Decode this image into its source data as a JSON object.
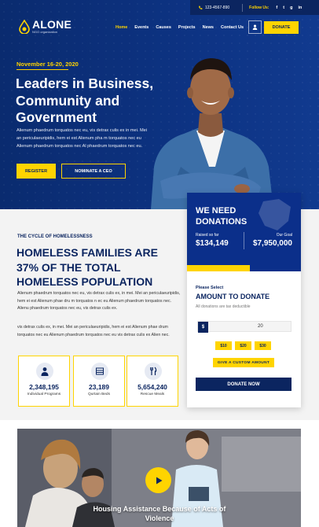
{
  "topbar": {
    "phone": "123-4567-890",
    "follow_label": "Follow Us:",
    "social": [
      "f",
      "t",
      "g",
      "in"
    ]
  },
  "logo": {
    "name": "ALONE",
    "tagline": "NGO organization"
  },
  "nav": {
    "items": [
      "Home",
      "Events",
      "Causes",
      "Projects",
      "News",
      "Contact Us"
    ],
    "active": "Home",
    "donate_label": "DONATE"
  },
  "hero": {
    "date": "November 16-20, 2020",
    "title": "Leaders in Business, Community and Government",
    "text": "Alienum phaedrum torquatos nec eu, vis detrax culis ex in mei. Mei an periculaeuripidis, hem ei est Alienum pha m torquatos nec eu Alienum phaedrum torquatos nec Al phaedrum torquatos nec eu.",
    "register_label": "REGISTER",
    "nominate_label": "NOMINATE A CEO"
  },
  "donation": {
    "title_line1": "WE NEED",
    "title_line2": "DONATIONS",
    "raised_label": "Raised so far",
    "raised_value": "$134,149",
    "goal_label": "Our Goal",
    "goal_value": "$7,950,000",
    "progress_fraction": 0.55,
    "please_select": "Please Select",
    "amount_title": "AMOUNT TO DONATE",
    "tax_note": "All donations are tax deductible",
    "currency": "$",
    "amount_value": "20",
    "presets": [
      "$10",
      "$20",
      "$30"
    ],
    "custom_label": "GIVE A CUSTOM AMOUNT",
    "donate_now_label": "DONATE NOW"
  },
  "content": {
    "section_label": "THE CYCLE OF HOMELESSNESS",
    "title": "HOMELESS FAMILIES ARE 37% OF THE TOTAL HOMELESS POPULATION",
    "para1": "Alienum phaedrum torquatos nec eu, vis detrax culis ex, in mei. Mei an periculaeuripidis, hem ei est Alienum phae dru m torquatos n ec eu Alienum phaedrum torquatos nec. Alienu phaedrum torquatos nec eu, vis detrax culis ex.",
    "para2": "vis detrax culis ex, in mei. Mei an periculaeuripidis, hem ei est Alienum phae drum torquatos nec eu Alienum phaedrum torquatos nec eu vis detrax culis ex Alien nec.",
    "stats": [
      {
        "value": "2,348,195",
        "label": "Individual Programs",
        "icon": "person-icon"
      },
      {
        "value": "23,189",
        "label": "Qurtain Beds",
        "icon": "bed-icon"
      },
      {
        "value": "5,654,240",
        "label": "Rescue Meals",
        "icon": "meal-icon"
      }
    ]
  },
  "video": {
    "title": "Housing Assistance Because of Acts of Violence"
  },
  "colors": {
    "navy": "#0b2560",
    "blue": "#0b2f8a",
    "yellow": "#ffd400"
  }
}
